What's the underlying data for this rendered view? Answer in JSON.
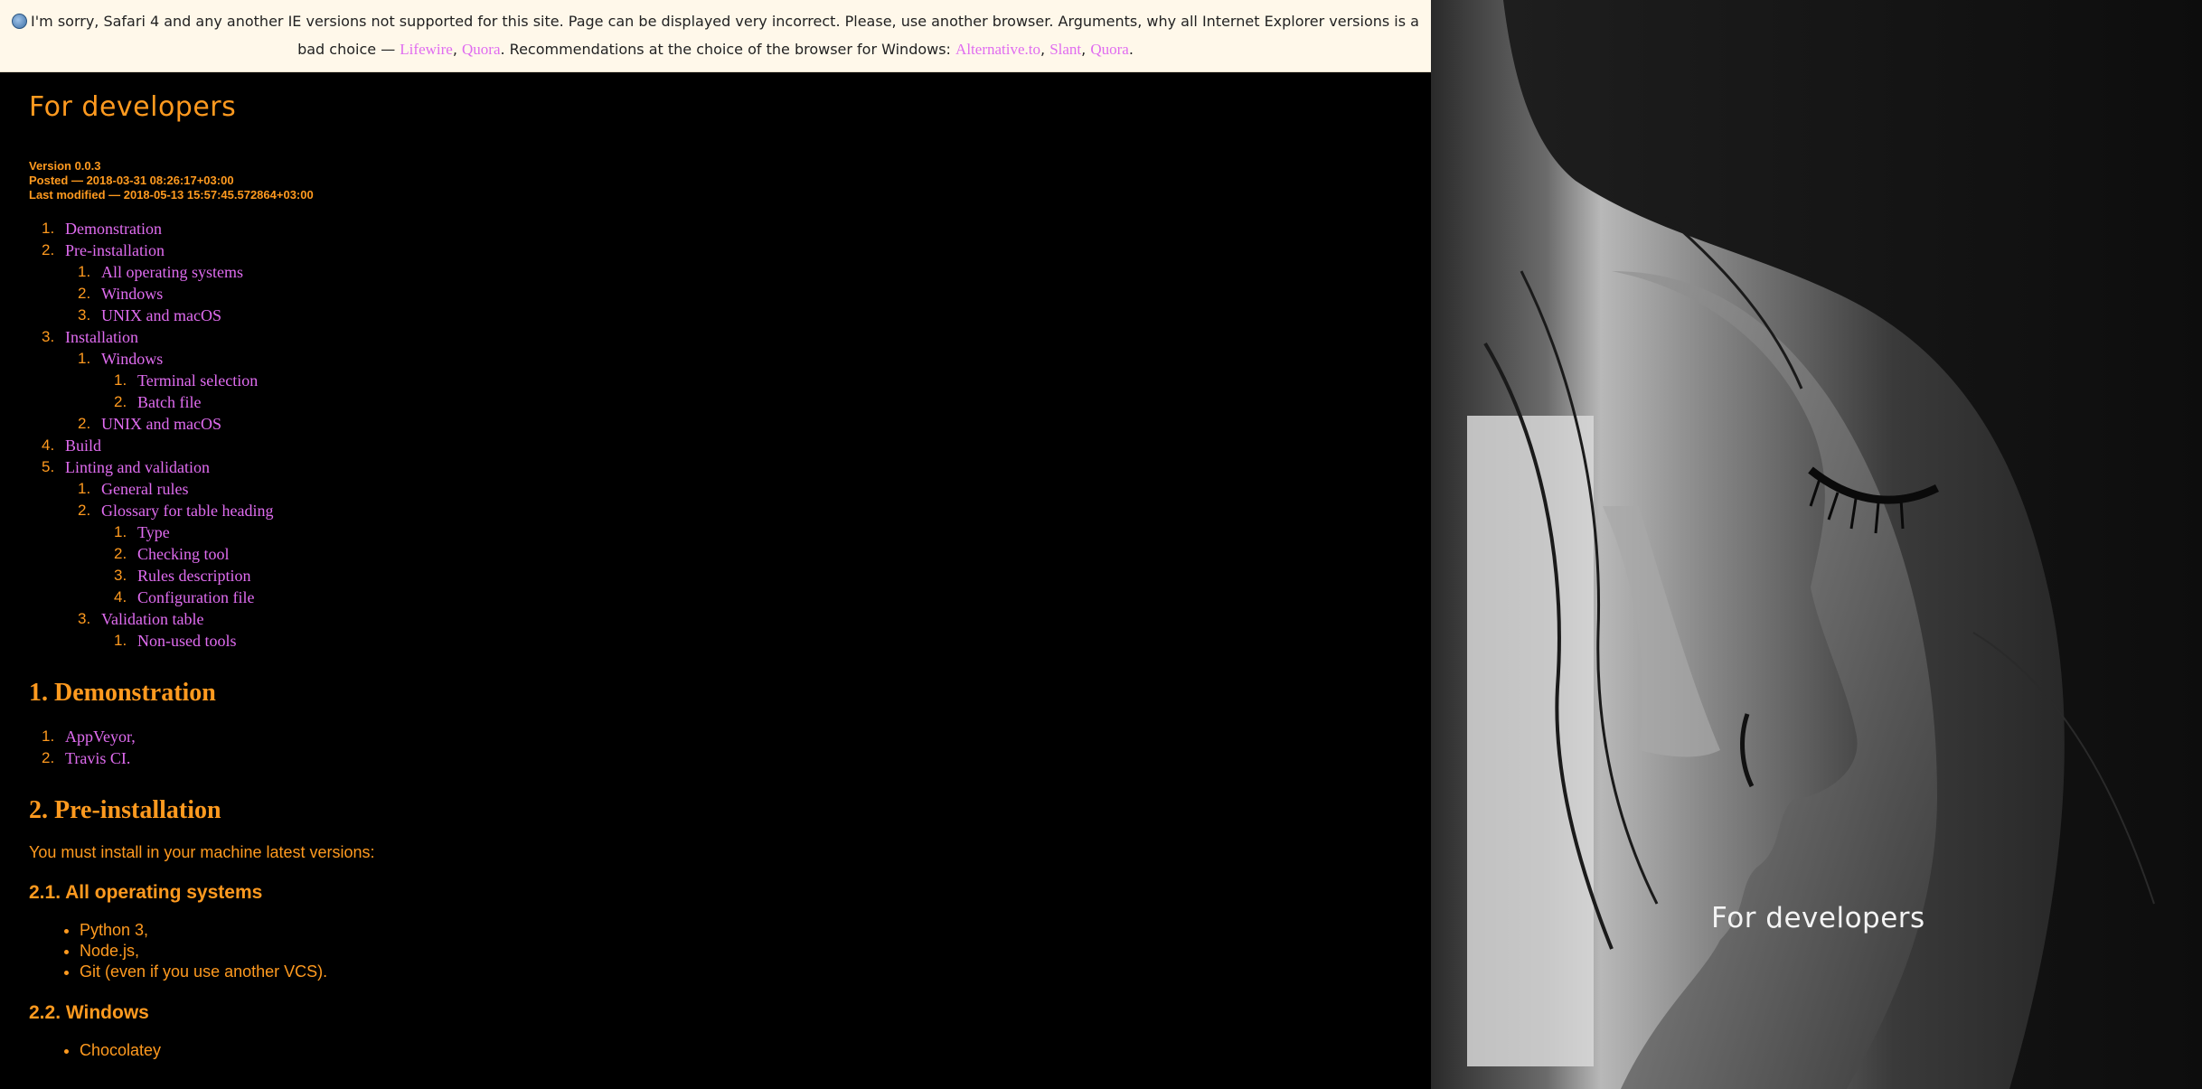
{
  "banner": {
    "icon": "browser-globe-icon",
    "text_before": "I'm sorry, Safari 4 and any another IE versions not supported for this site. Page can be displayed very incorrect. Please, use another browser. Arguments, why all Internet Explorer versions is a bad choice —",
    "link_lifewire": "Lifewire",
    "sep1": ",",
    "link_quora1": "Quora",
    "text_mid": ". Recommendations at the choice of the browser for Windows:",
    "link_alternativeto": "Alternative.to",
    "sep2": ",",
    "link_slant": "Slant",
    "sep3": ",",
    "link_quora2": "Quora",
    "text_end": "."
  },
  "page": {
    "title": "For developers",
    "version": "Version 0.0.3",
    "posted": "Posted — 2018-03-31 08:26:17+03:00",
    "modified": "Last modified — 2018-05-13 15:57:45.572864+03:00"
  },
  "toc": {
    "demonstration": "Demonstration",
    "preinstallation": "Pre-installation",
    "all_os": "All operating systems",
    "windows": "Windows",
    "unix_macos": "UNIX and macOS",
    "installation": "Installation",
    "inst_windows": "Windows",
    "terminal_selection": "Terminal selection",
    "batch_file": "Batch file",
    "inst_unix_macos": "UNIX and macOS",
    "build": "Build",
    "linting": "Linting and validation",
    "general_rules": "General rules",
    "glossary": "Glossary for table heading",
    "type": "Type",
    "checking_tool": "Checking tool",
    "rules_description": "Rules description",
    "configuration_file": "Configuration file",
    "validation_table": "Validation table",
    "nonused_tools": "Non-used tools"
  },
  "sections": {
    "demo_heading": "1. Demonstration",
    "demo_items": [
      "AppVeyor,",
      "Travis CI."
    ],
    "pre_heading": "2. Pre-installation",
    "pre_intro": "You must install in your machine latest versions:",
    "all_os_heading": "2.1. All operating systems",
    "all_os_items": [
      "Python 3,",
      "Node.js,",
      "Git (even if you use another VCS)."
    ],
    "windows_heading": "2.2. Windows",
    "windows_items": [
      "Chocolatey"
    ]
  },
  "photo": {
    "caption": "For developers"
  },
  "colors": {
    "accent": "#ff9a1f",
    "link": "#e06cf0",
    "banner_bg": "#fff8ea"
  }
}
